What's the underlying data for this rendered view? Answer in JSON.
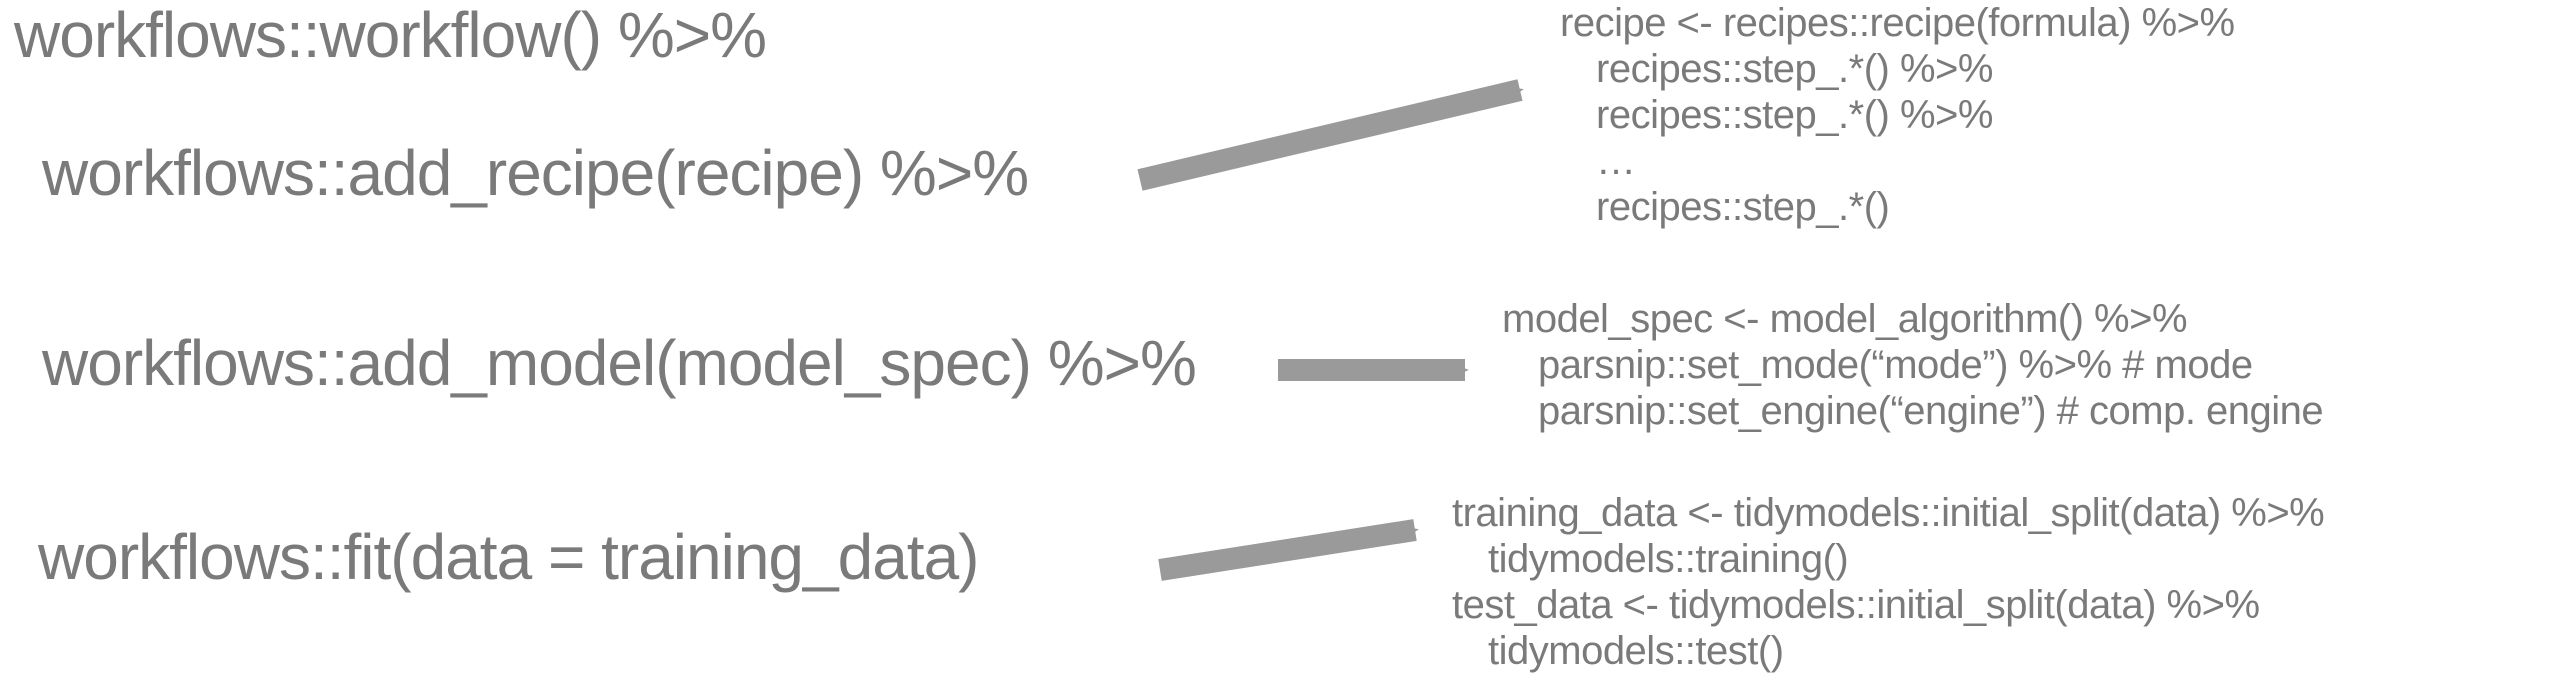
{
  "left": {
    "line1": "workflows::workflow() %>%",
    "line2": "workflows::add_recipe(recipe) %>%",
    "line3": "workflows::add_model(model_spec) %>%",
    "line4": "workflows::fit(data = training_data)"
  },
  "recipe_block": {
    "l1": "recipe <- recipes::recipe(formula) %>%",
    "l2": "recipes::step_.*() %>%",
    "l3": "recipes::step_.*() %>%",
    "l4": "…",
    "l5": "recipes::step_.*()"
  },
  "model_block": {
    "l1": "model_spec <- model_algorithm() %>%",
    "l2": "parsnip::set_mode(“mode”) %>% # mode",
    "l3": "parsnip::set_engine(“engine”) # comp. engine"
  },
  "data_block": {
    "l1": "training_data <- tidymodels::initial_split(data) %>%",
    "l2": "tidymodels::training()",
    "l3": "test_data <- tidymodels::initial_split(data) %>%",
    "l4": "tidymodels::test()"
  }
}
